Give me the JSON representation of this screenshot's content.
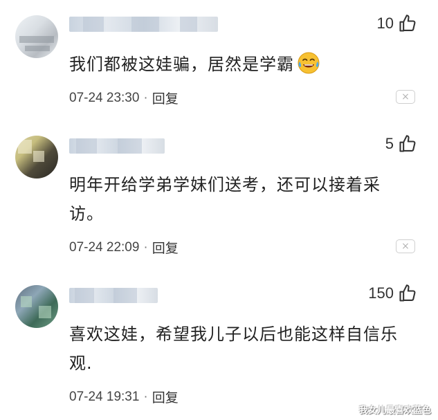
{
  "comments": [
    {
      "text": "我们都被这娃骗，居然是学霸",
      "emoji": "crying-laughing-emoji",
      "likes": "10",
      "date": "07-24 23:30",
      "separator": "·",
      "reply": "回复",
      "close": "×"
    },
    {
      "text": "明年开给学弟学妹们送考，还可以接着采访。",
      "likes": "5",
      "date": "07-24 22:09",
      "separator": "·",
      "reply": "回复",
      "close": "×"
    },
    {
      "text": "喜欢这娃，希望我儿子以后也能这样自信乐观.",
      "likes": "150",
      "date": "07-24 19:31",
      "separator": "·",
      "reply": "回复",
      "close": "×"
    }
  ],
  "watermark": "我女儿最喜欢蓝色",
  "colors": {
    "text": "#222222",
    "meta": "#444444",
    "close_border": "#cfcfcf"
  }
}
